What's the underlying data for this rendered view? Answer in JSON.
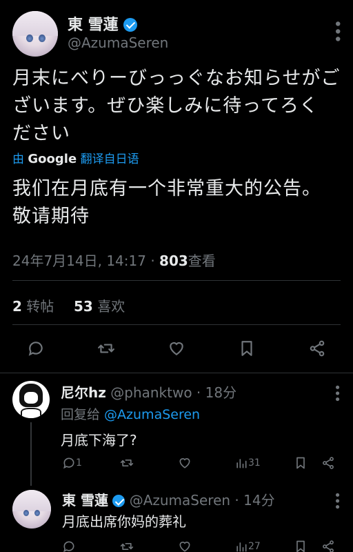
{
  "main_tweet": {
    "display_name": "東 雪蓮",
    "handle": "@AzumaSeren",
    "text_line1": "月末にべりーびっっぐなお知らせがご",
    "text_line2": "ざいます。ぜひ楽しみに待ってろく",
    "text_line3": "ださい",
    "translate_prefix": "由",
    "translate_brand": "Google",
    "translate_suffix": "翻译自日语",
    "translated_line1": "我们在月底有一个非常重大的公告。",
    "translated_line2": "敬请期待",
    "timestamp": "24年7月14日, 14:17 · ",
    "views_count": "803",
    "views_label": "查看",
    "reposts_count": "2",
    "reposts_label": "转帖",
    "likes_count": "53",
    "likes_label": "喜欢"
  },
  "replies": [
    {
      "display_name": "尼尔hz",
      "handle": "@phanktwo · 18分",
      "reply_to_prefix": "回复给 ",
      "reply_to_handle": "@AzumaSeren",
      "text": "月底下海了?",
      "reply_count": "1",
      "view_count": "31"
    },
    {
      "display_name": "東 雪蓮",
      "handle": "@AzumaSeren · 14分",
      "text": "月底出席你妈的葬礼",
      "view_count": "27"
    }
  ],
  "colors": {
    "background": "#000000",
    "accent": "#1d9bf0",
    "muted": "#71767b",
    "text": "#e7e9ea"
  }
}
